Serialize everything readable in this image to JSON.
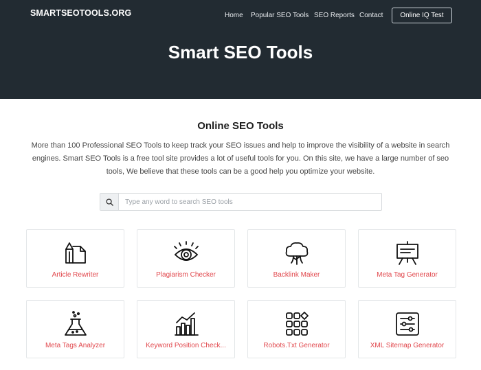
{
  "header": {
    "logo": "SMARTSEOTOOLS.ORG",
    "nav": {
      "home": "Home",
      "popular": "Popular SEO Tools",
      "reports": "SEO Reports",
      "contact": "Contact"
    },
    "cta": "Online IQ Test",
    "hero_title": "Smart SEO Tools"
  },
  "intro": {
    "title": "Online SEO Tools",
    "text": "More than 100 Professional SEO Tools to keep track your SEO issues and help to improve the visibility of a website in search engines. Smart SEO Tools is a free tool site provides a lot of useful tools for you. On this site, we have a large number of seo tools, We believe that these tools can be a good help you optimize your website."
  },
  "search": {
    "placeholder": "Type any word to search SEO tools",
    "icon": "search-icon"
  },
  "tools": [
    {
      "label": "Article Rewriter",
      "icon": "document-rewrite-icon"
    },
    {
      "label": "Plagiarism Checker",
      "icon": "eye-icon"
    },
    {
      "label": "Backlink Maker",
      "icon": "tree-icon"
    },
    {
      "label": "Meta Tag Generator",
      "icon": "presentation-board-icon"
    },
    {
      "label": "Meta Tags Analyzer",
      "icon": "flask-icon"
    },
    {
      "label": "Keyword Position Check...",
      "icon": "bar-chart-icon"
    },
    {
      "label": "Robots.Txt Generator",
      "icon": "grid-icon"
    },
    {
      "label": "XML Sitemap Generator",
      "icon": "sliders-icon"
    }
  ],
  "colors": {
    "hero_bg": "#222b32",
    "accent": "#e1474c"
  }
}
